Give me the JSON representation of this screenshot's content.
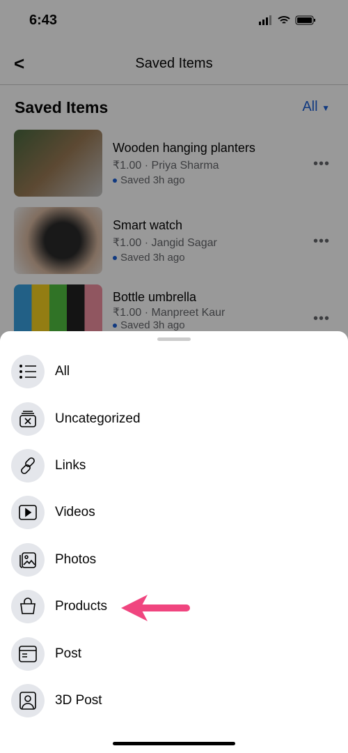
{
  "status": {
    "time": "6:43"
  },
  "nav": {
    "title": "Saved Items"
  },
  "header": {
    "title": "Saved Items",
    "filter": "All",
    "filter_color": "#1b5fd6"
  },
  "items": [
    {
      "title": "Wooden hanging planters",
      "sub": "₹1.00 · Priya Sharma",
      "saved": "Saved 3h ago"
    },
    {
      "title": "Smart watch",
      "sub": "₹1.00 · Jangid Sagar",
      "saved": "Saved 3h ago"
    },
    {
      "title": "Bottle umbrella",
      "sub": "₹1.00 · Manpreet Kaur",
      "saved": "Saved 3h ago"
    }
  ],
  "sheet": {
    "options": [
      {
        "label": "All",
        "icon": "list-icon"
      },
      {
        "label": "Uncategorized",
        "icon": "uncategorized-icon"
      },
      {
        "label": "Links",
        "icon": "link-icon"
      },
      {
        "label": "Videos",
        "icon": "video-icon"
      },
      {
        "label": "Photos",
        "icon": "photos-icon"
      },
      {
        "label": "Products",
        "icon": "shopping-bag-icon"
      },
      {
        "label": "Post",
        "icon": "post-icon"
      },
      {
        "label": "3D Post",
        "icon": "3d-post-icon"
      }
    ]
  },
  "annotation_color": "#f0457f"
}
